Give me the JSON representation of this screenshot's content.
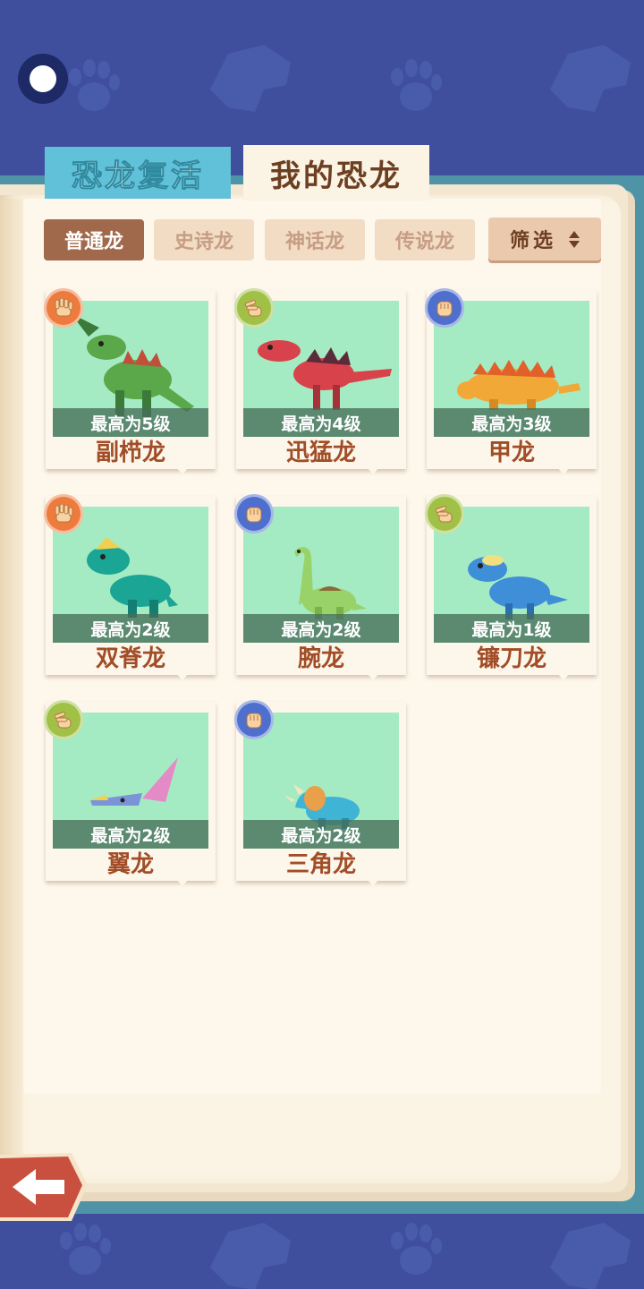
{
  "tabs": {
    "revive": "恐龙复活",
    "mine": "我的恐龙"
  },
  "rarity": [
    {
      "label": "普通龙",
      "active": true
    },
    {
      "label": "史诗龙",
      "active": false
    },
    {
      "label": "神话龙",
      "active": false
    },
    {
      "label": "传说龙",
      "active": false
    }
  ],
  "filter": {
    "label": "筛选"
  },
  "dinos": [
    {
      "name": "副栉龙",
      "level": "最高为5级",
      "hand": "palm",
      "badge_color": "#ee7b3e",
      "body_color": "#5aa84a"
    },
    {
      "name": "迅猛龙",
      "level": "最高为4级",
      "hand": "scissors",
      "badge_color": "#a0c146",
      "body_color": "#d8424a"
    },
    {
      "name": "甲龙",
      "level": "最高为3级",
      "hand": "fist",
      "badge_color": "#4f6fcf",
      "body_color": "#f2a836"
    },
    {
      "name": "双脊龙",
      "level": "最高为2级",
      "hand": "palm",
      "badge_color": "#ee7b3e",
      "body_color": "#1aa594"
    },
    {
      "name": "腕龙",
      "level": "最高为2级",
      "hand": "fist",
      "badge_color": "#4f6fcf",
      "body_color": "#9ad26a"
    },
    {
      "name": "镰刀龙",
      "level": "最高为1级",
      "hand": "scissors",
      "badge_color": "#a0c146",
      "body_color": "#3f8ed8"
    },
    {
      "name": "翼龙",
      "level": "最高为2级",
      "hand": "scissors",
      "badge_color": "#a0c146",
      "body_color": "#7b94d8"
    },
    {
      "name": "三角龙",
      "level": "最高为2级",
      "hand": "fist",
      "badge_color": "#4f6fcf",
      "body_color": "#3fb4d4"
    }
  ]
}
